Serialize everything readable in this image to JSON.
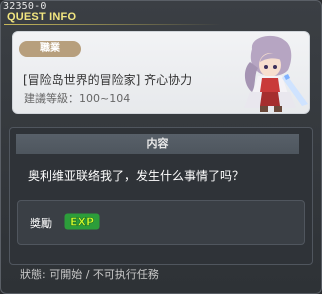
{
  "quest_id": "32350-0",
  "window_title": "QUEST INFO",
  "job_pill_label": "職業",
  "quest_name": "[冒险岛世界的冒险家] 齐心协力",
  "recommended_level": "建議等級：100~104",
  "content_header": "内容",
  "content_text": "奥利维亚联络我了，发生什么事情了吗？",
  "reward_label": "獎勵",
  "reward_icon": "EXP",
  "status_text": "狀態: 可開始 / 不可执行任務",
  "colors": {
    "title": "#f2e680",
    "job_pill": "#b79f7d",
    "panel_bg": "#2f3338",
    "exp_yellow": "#d8ff2a",
    "exp_green": "#2c9d3a"
  },
  "icons": {
    "avatar": "character-portrait",
    "reward": "exp-icon"
  }
}
